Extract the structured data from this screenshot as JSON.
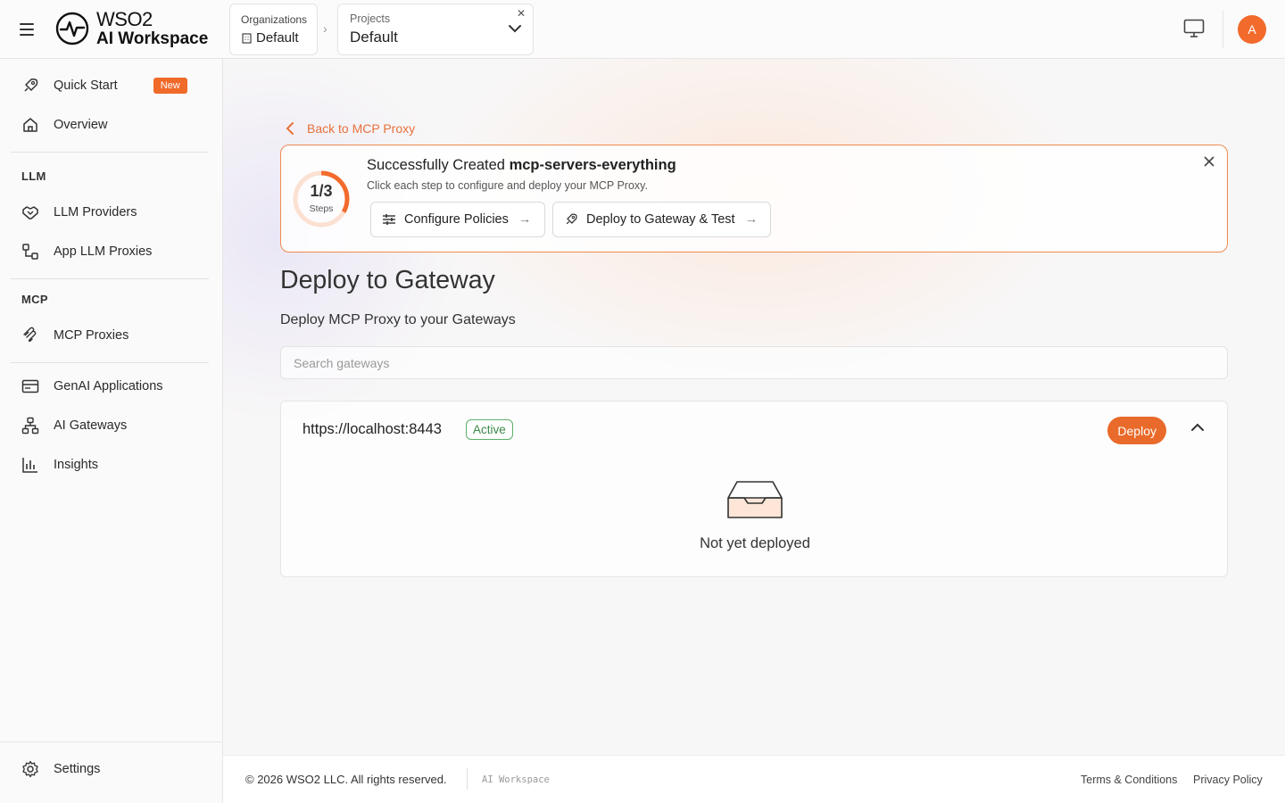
{
  "header": {
    "logo_line1": "WSO2",
    "logo_line2": "AI Workspace",
    "org_label": "Organizations",
    "org_value": "Default",
    "project_label": "Projects",
    "project_value": "Default",
    "avatar_initial": "A"
  },
  "sidebar": {
    "quick_start": "Quick Start",
    "new_badge": "New",
    "overview": "Overview",
    "llm_section": "LLM",
    "llm_providers": "LLM Providers",
    "app_llm_proxies": "App LLM Proxies",
    "mcp_section": "MCP",
    "mcp_proxies": "MCP Proxies",
    "genai_applications": "GenAI Applications",
    "ai_gateways": "AI Gateways",
    "insights": "Insights",
    "settings": "Settings"
  },
  "main": {
    "back_link": "Back to MCP Proxy",
    "banner": {
      "title_prefix": "Successfully Created ",
      "title_name": "mcp-servers-everything",
      "subtitle": "Click each step to configure and deploy your MCP Proxy.",
      "progress_text": "1/3",
      "progress_fraction": 0.333,
      "steps_label": "Steps",
      "step1": "Configure Policies",
      "step2": "Deploy to Gateway & Test"
    },
    "title": "Deploy to Gateway",
    "subtitle": "Deploy MCP Proxy to your Gateways",
    "search_placeholder": "Search gateways",
    "gateway": {
      "url": "https://localhost:8443",
      "status": "Active",
      "deploy_label": "Deploy",
      "empty_text": "Not yet deployed"
    }
  },
  "footer": {
    "copyright": "© 2026 WSO2 LLC. All rights reserved.",
    "brand": "AI Workspace",
    "terms": "Terms & Conditions",
    "privacy": "Privacy Policy"
  },
  "colors": {
    "accent": "#f26b2d",
    "active_green": "#3b8a46"
  }
}
